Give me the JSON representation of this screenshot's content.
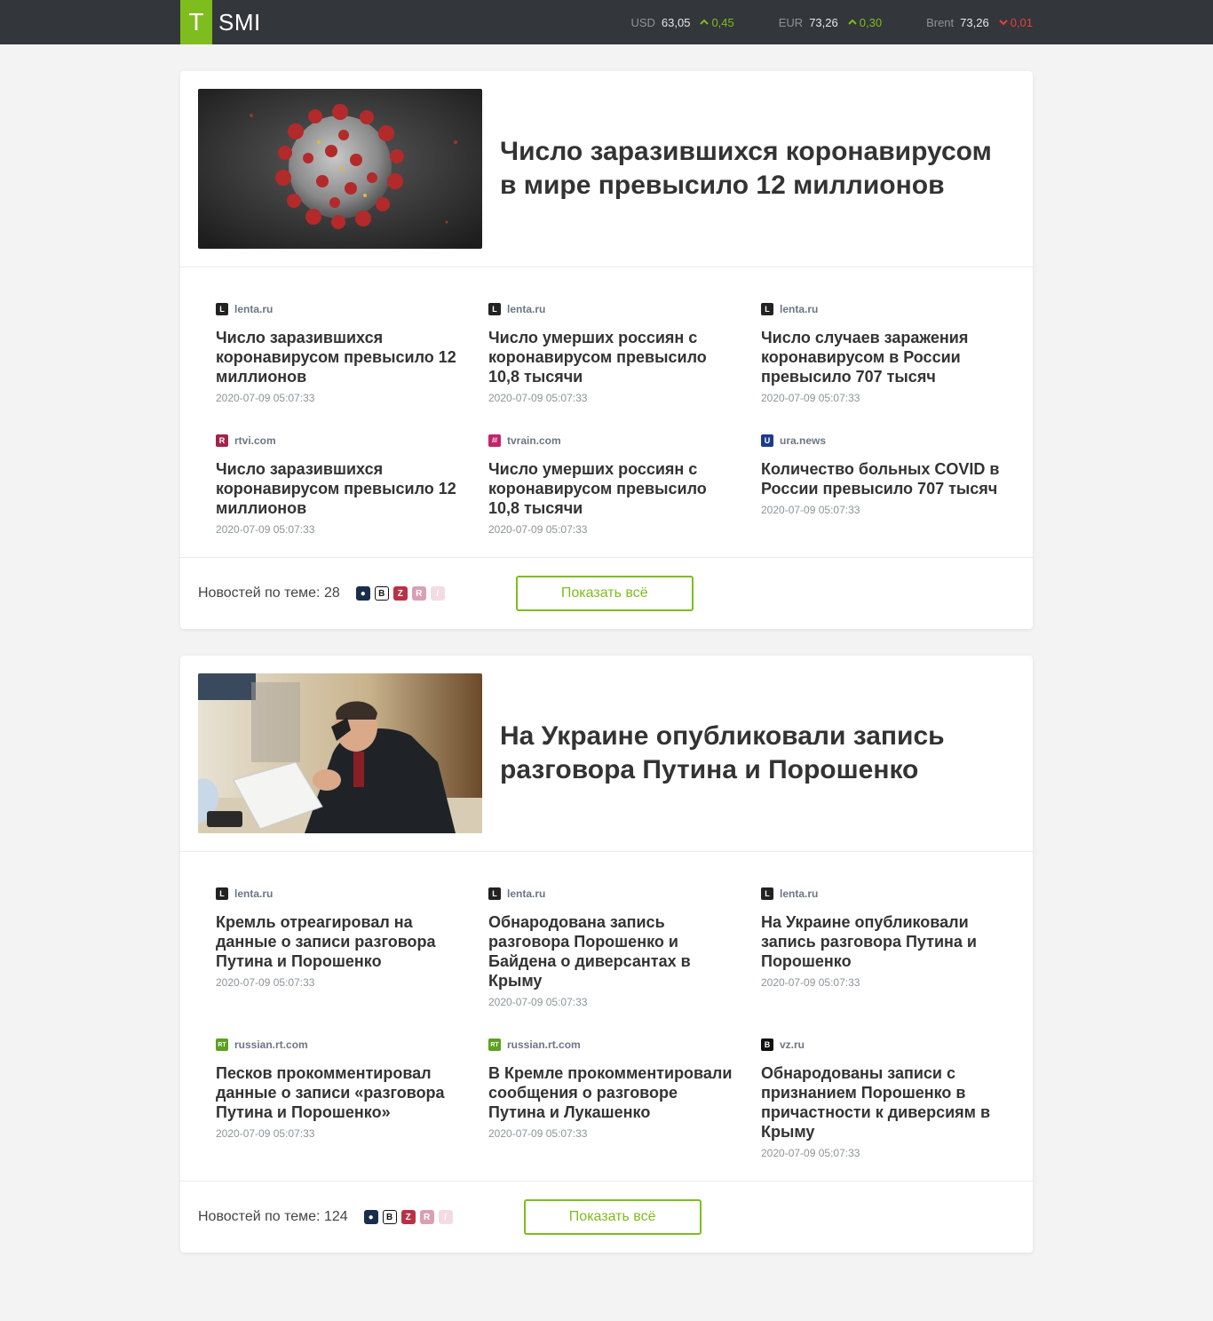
{
  "header": {
    "logo_letter": "T",
    "logo_text": "SMI",
    "rates": [
      {
        "name": "USD",
        "value": "63,05",
        "change": "0,45",
        "direction": "up"
      },
      {
        "name": "EUR",
        "value": "73,26",
        "change": "0,30",
        "direction": "up"
      },
      {
        "name": "Brent",
        "value": "73,26",
        "change": "0,01",
        "direction": "down"
      }
    ]
  },
  "colors": {
    "accent": "#7ebd1d",
    "down": "#e8413a",
    "header_bg": "#33363b"
  },
  "stories": [
    {
      "title": "Число заразившихся коронавирусом в мире превысило 12 миллионов",
      "image": "coronavirus-illustration",
      "items": [
        {
          "source": "lenta.ru",
          "icon_letter": "L",
          "title": "Число заразившихся коронавирусом превысило 12 миллионов",
          "date": "2020-07-09 05:07:33"
        },
        {
          "source": "lenta.ru",
          "icon_letter": "L",
          "title": "Число умерших россиян с коронавирусом превысило 10,8 тысячи",
          "date": "2020-07-09 05:07:33"
        },
        {
          "source": "lenta.ru",
          "icon_letter": "L",
          "title": "Число случаев заражения коронавирусом в России превысило 707 тысяч",
          "date": "2020-07-09 05:07:33"
        },
        {
          "source": "rtvi.com",
          "icon_letter": "R",
          "title": "Число заразившихся коронавирусом превысило 12 миллионов",
          "date": "2020-07-09 05:07:33"
        },
        {
          "source": "tvrain.com",
          "icon_letter": "///",
          "title": "Число умерших россиян с коронавирусом превысило 10,8 тысячи",
          "date": "2020-07-09 05:07:33"
        },
        {
          "source": "ura.news",
          "icon_letter": "U",
          "title": "Количество больных COVID в России превысило 707 тысяч",
          "date": "2020-07-09 05:07:33"
        }
      ],
      "count_label": "Новостей по теме: 28",
      "show_all": "Показать всё"
    },
    {
      "title": "На Украине опубликовали запись разговора Путина и Порошенко",
      "image": "man-on-phone-photo",
      "items": [
        {
          "source": "lenta.ru",
          "icon_letter": "L",
          "title": "Кремль отреагировал на данные о записи разговора Путина и Порошенко",
          "date": "2020-07-09 05:07:33"
        },
        {
          "source": "lenta.ru",
          "icon_letter": "L",
          "title": "Обнародована запись разговора Порошенко и Байдена о диверсантах в Крыму",
          "date": "2020-07-09 05:07:33"
        },
        {
          "source": "lenta.ru",
          "icon_letter": "L",
          "title": "На Украине опубликовали запись разговора Путина и Порошенко",
          "date": "2020-07-09 05:07:33"
        },
        {
          "source": "russian.rt.com",
          "icon_letter": "RT",
          "title": "Песков прокомментировал данные о записи «разговора Путина и Порошенко»",
          "date": "2020-07-09 05:07:33"
        },
        {
          "source": "russian.rt.com",
          "icon_letter": "RT",
          "title": "В Кремле прокомментировали сообщения о разговоре Путина и Лукашенко",
          "date": "2020-07-09 05:07:33"
        },
        {
          "source": "vz.ru",
          "icon_letter": "B",
          "title": "Обнародованы записи с признанием Порошенко в причастности к диверсиям в Крыму",
          "date": "2020-07-09 05:07:33"
        }
      ],
      "count_label": "Новостей по теме: 124",
      "show_all": "Показать всё"
    }
  ]
}
